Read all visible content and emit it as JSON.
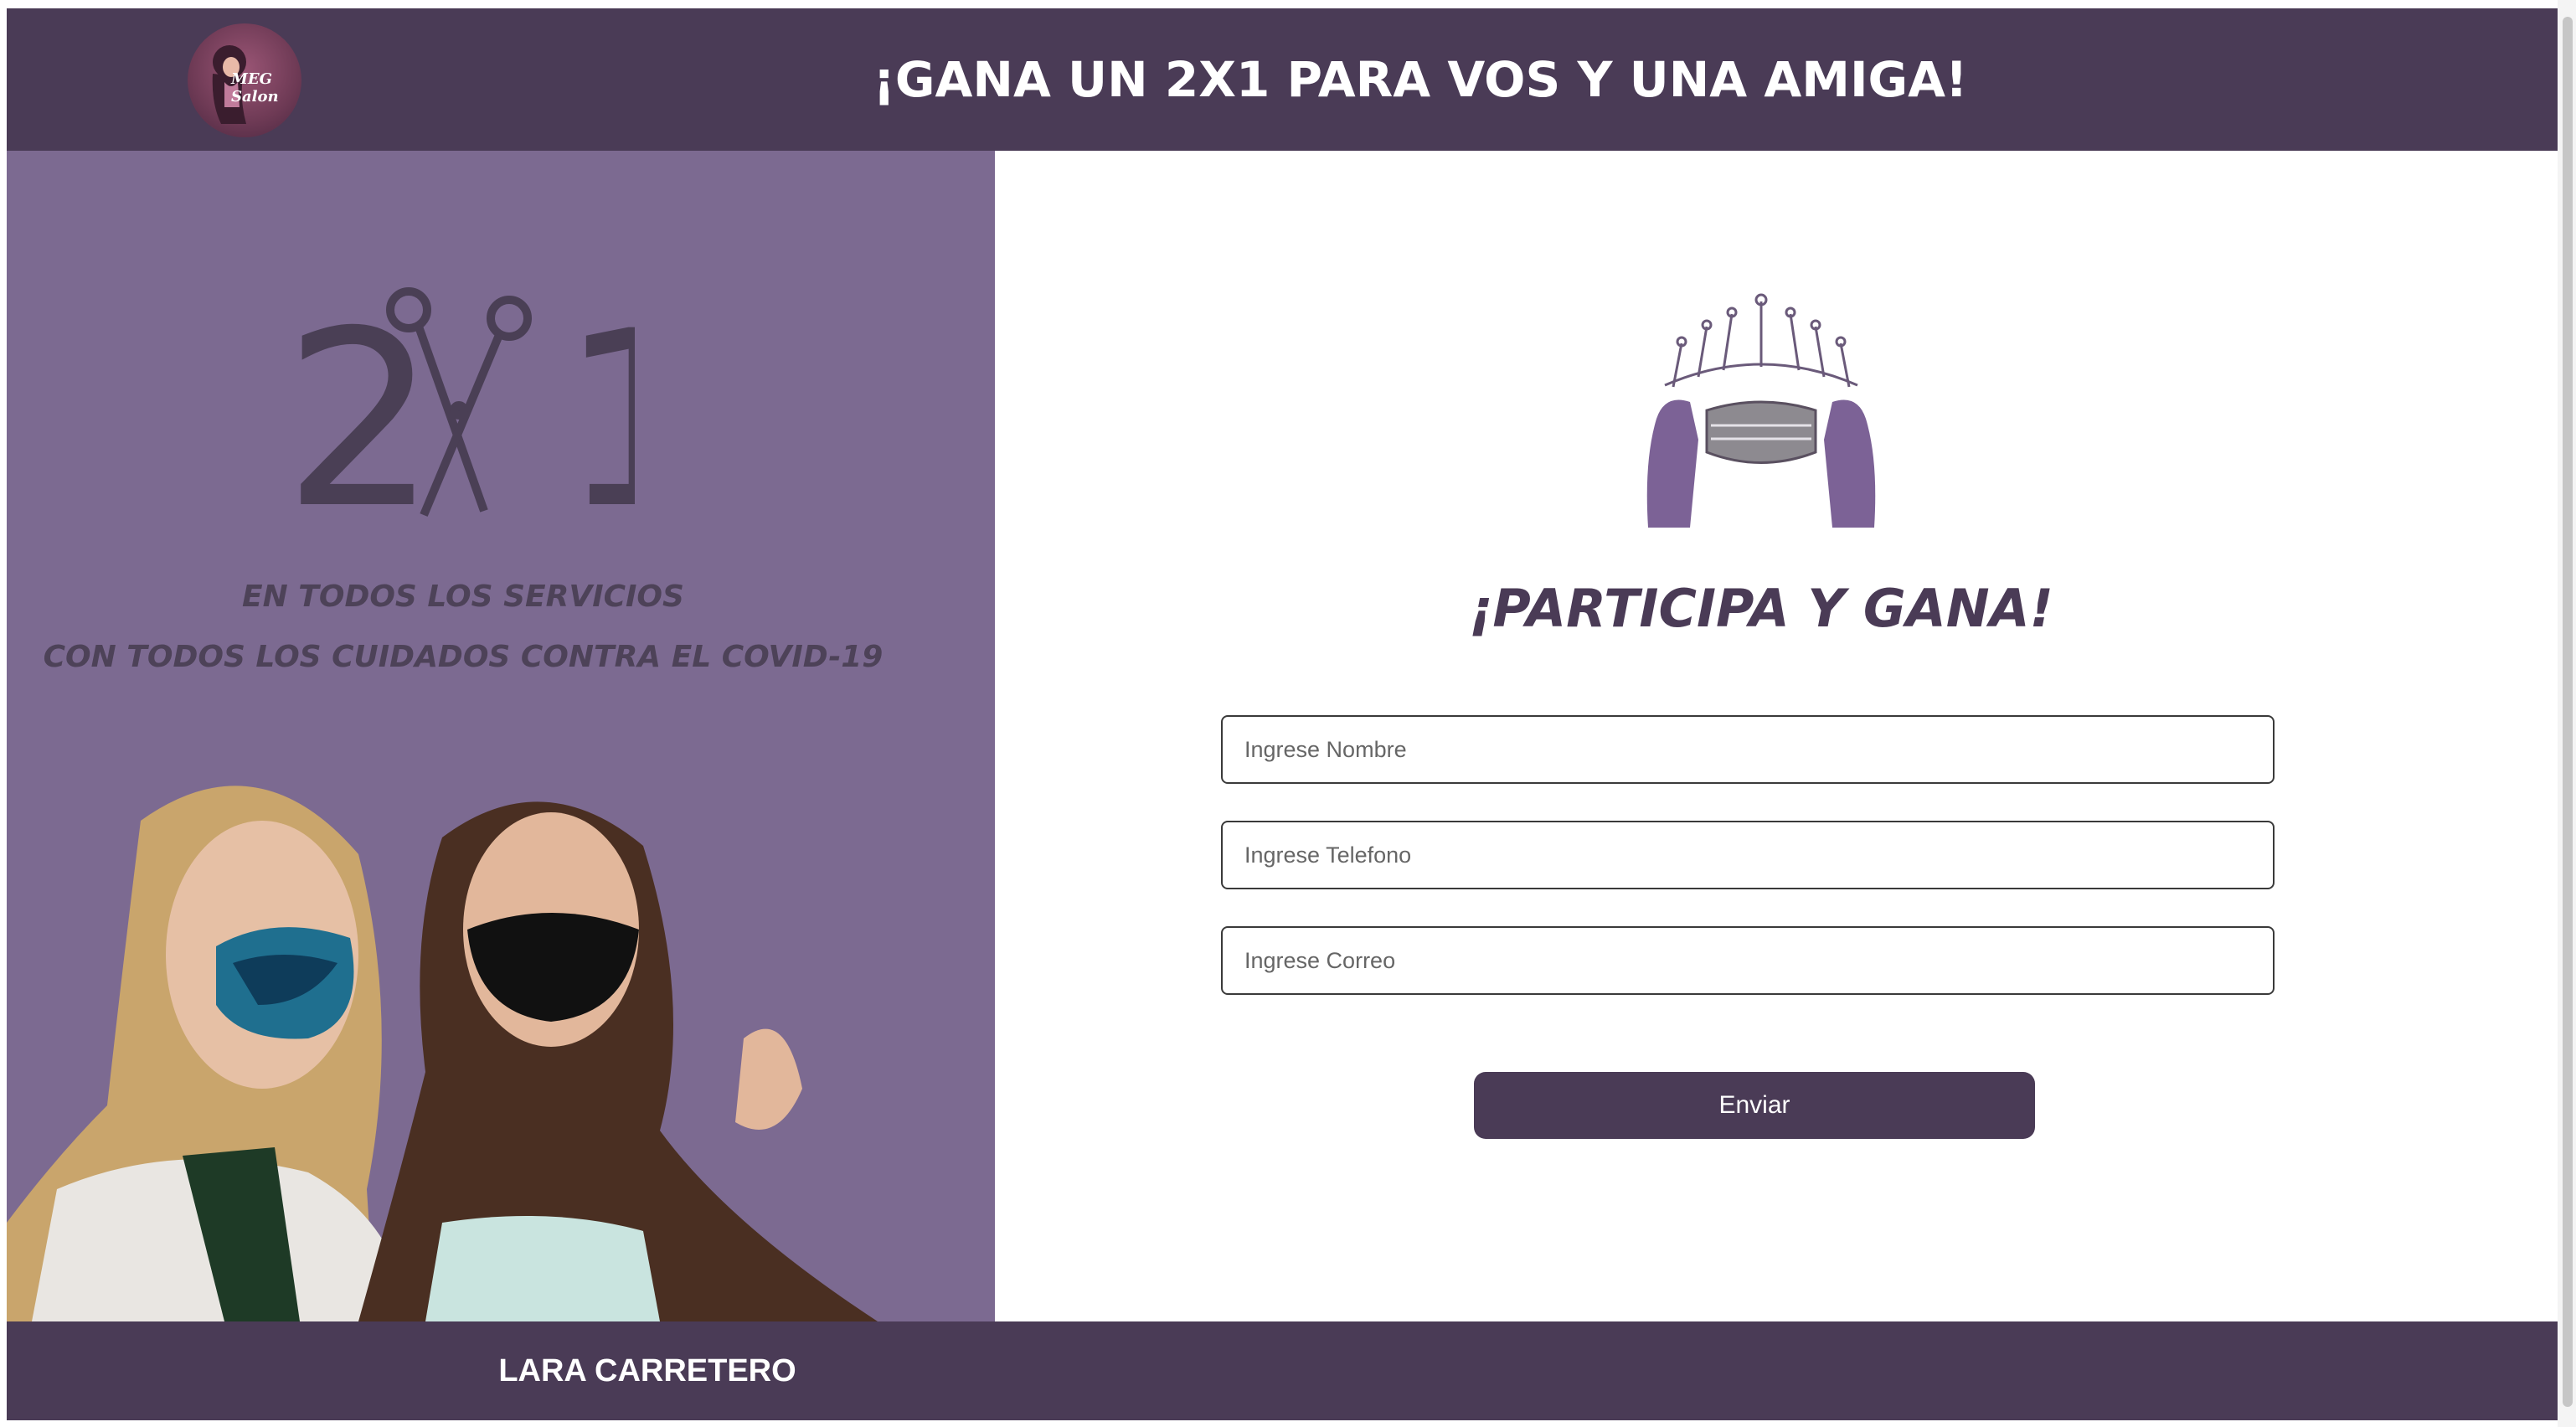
{
  "header": {
    "logo_text": "MEG Salon",
    "title": "¡GANA UN 2X1 PARA VOS Y UNA AMIGA!"
  },
  "promo": {
    "big_text": "2X1",
    "line1": "EN TODOS LOS SERVICIOS",
    "line2": "CON TODOS LOS CUIDADOS CONTRA EL COVID-19"
  },
  "form": {
    "title": "¡PARTICIPA Y GANA!",
    "name_placeholder": "Ingrese Nombre",
    "phone_placeholder": "Ingrese Telefono",
    "email_placeholder": "Ingrese Correo",
    "submit_label": "Enviar"
  },
  "footer": {
    "text": "LARA CARRETERO"
  },
  "colors": {
    "brand_dark": "#4a3b56",
    "panel_purple": "#7c6a91",
    "text_muted": "#4d4258"
  }
}
